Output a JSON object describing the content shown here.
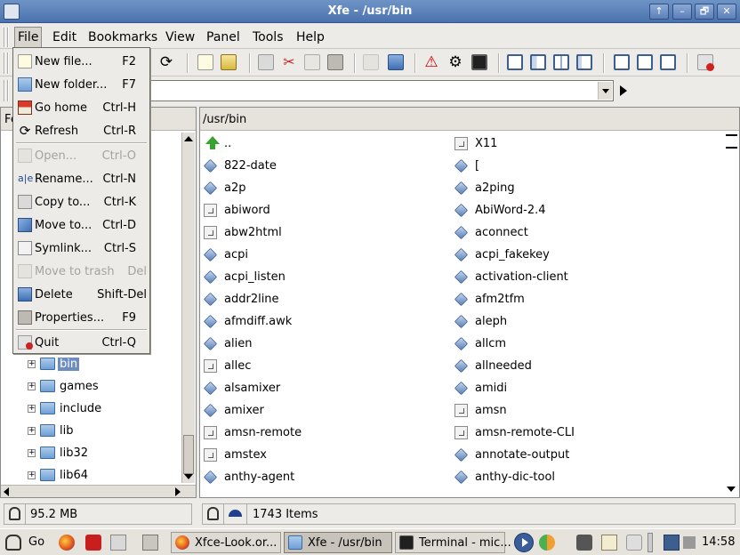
{
  "window": {
    "title": "Xfe - /usr/bin",
    "controls": [
      "↑",
      "–",
      "🗗",
      "✕"
    ]
  },
  "menubar": {
    "items": [
      {
        "label": "File",
        "open": true
      },
      {
        "label": "Edit"
      },
      {
        "label": "Bookmarks"
      },
      {
        "label": "View"
      },
      {
        "label": "Panel"
      },
      {
        "label": "Tools"
      },
      {
        "label": "Help"
      }
    ]
  },
  "file_menu": {
    "items": [
      {
        "label": "New file...",
        "shortcut": "F2",
        "icon": "new-file-icon",
        "enabled": true
      },
      {
        "label": "New folder...",
        "shortcut": "F7",
        "icon": "new-folder-icon",
        "enabled": true
      },
      {
        "label": "Go home",
        "shortcut": "Ctrl-H",
        "icon": "home-icon",
        "enabled": true
      },
      {
        "label": "Refresh",
        "shortcut": "Ctrl-R",
        "icon": "refresh-icon",
        "enabled": true
      },
      {
        "label": "Open...",
        "shortcut": "Ctrl-O",
        "icon": "open-icon",
        "enabled": false
      },
      {
        "label": "Rename...",
        "shortcut": "Ctrl-N",
        "icon": "rename-icon",
        "enabled": true
      },
      {
        "label": "Copy to...",
        "shortcut": "Ctrl-K",
        "icon": "copy-icon",
        "enabled": true
      },
      {
        "label": "Move to...",
        "shortcut": "Ctrl-D",
        "icon": "move-icon",
        "enabled": true
      },
      {
        "label": "Symlink...",
        "shortcut": "Ctrl-S",
        "icon": "symlink-icon",
        "enabled": true
      },
      {
        "label": "Move to trash",
        "shortcut": "Del",
        "icon": "trash-icon",
        "enabled": false
      },
      {
        "label": "Delete",
        "shortcut": "Shift-Del",
        "icon": "delete-icon",
        "enabled": true
      },
      {
        "label": "Properties...",
        "shortcut": "F9",
        "icon": "properties-icon",
        "enabled": true
      },
      {
        "label": "Quit",
        "shortcut": "Ctrl-Q",
        "icon": "quit-icon",
        "enabled": true
      }
    ]
  },
  "location": {
    "value": ""
  },
  "left_panel": {
    "header": "Fo",
    "tree": [
      {
        "label": "bin",
        "selected": true
      },
      {
        "label": "games",
        "selected": false
      },
      {
        "label": "include",
        "selected": false
      },
      {
        "label": "lib",
        "selected": false
      },
      {
        "label": "lib32",
        "selected": false
      },
      {
        "label": "lib64",
        "selected": false
      }
    ]
  },
  "right_panel": {
    "header": "/usr/bin",
    "files": [
      {
        "name": "..",
        "icon": "up-arrow"
      },
      {
        "name": "X11",
        "icon": "link"
      },
      {
        "name": "822-date",
        "icon": "exec"
      },
      {
        "name": "[",
        "icon": "exec"
      },
      {
        "name": "a2p",
        "icon": "exec"
      },
      {
        "name": "a2ping",
        "icon": "exec"
      },
      {
        "name": "abiword",
        "icon": "link"
      },
      {
        "name": "AbiWord-2.4",
        "icon": "exec"
      },
      {
        "name": "abw2html",
        "icon": "link"
      },
      {
        "name": "aconnect",
        "icon": "exec"
      },
      {
        "name": "acpi",
        "icon": "exec"
      },
      {
        "name": "acpi_fakekey",
        "icon": "exec"
      },
      {
        "name": "acpi_listen",
        "icon": "exec"
      },
      {
        "name": "activation-client",
        "icon": "exec"
      },
      {
        "name": "addr2line",
        "icon": "exec"
      },
      {
        "name": "afm2tfm",
        "icon": "exec"
      },
      {
        "name": "afmdiff.awk",
        "icon": "exec"
      },
      {
        "name": "aleph",
        "icon": "exec"
      },
      {
        "name": "alien",
        "icon": "exec"
      },
      {
        "name": "allcm",
        "icon": "exec"
      },
      {
        "name": "allec",
        "icon": "link"
      },
      {
        "name": "allneeded",
        "icon": "exec"
      },
      {
        "name": "alsamixer",
        "icon": "exec"
      },
      {
        "name": "amidi",
        "icon": "exec"
      },
      {
        "name": "amixer",
        "icon": "exec"
      },
      {
        "name": "amsn",
        "icon": "link"
      },
      {
        "name": "amsn-remote",
        "icon": "link"
      },
      {
        "name": "amsn-remote-CLI",
        "icon": "link"
      },
      {
        "name": "amstex",
        "icon": "link"
      },
      {
        "name": "annotate-output",
        "icon": "exec"
      },
      {
        "name": "anthy-agent",
        "icon": "exec"
      },
      {
        "name": "anthy-dic-tool",
        "icon": "exec"
      }
    ]
  },
  "status": {
    "left": "95.2 MB",
    "right": "1743 Items"
  },
  "taskbar": {
    "go_label": "Go",
    "tasks": [
      {
        "label": "Xfce-Look.or...",
        "active": false
      },
      {
        "label": "Xfe - /usr/bin",
        "active": true
      },
      {
        "label": "Terminal - mic...",
        "active": false
      }
    ],
    "clock": "14:58"
  }
}
